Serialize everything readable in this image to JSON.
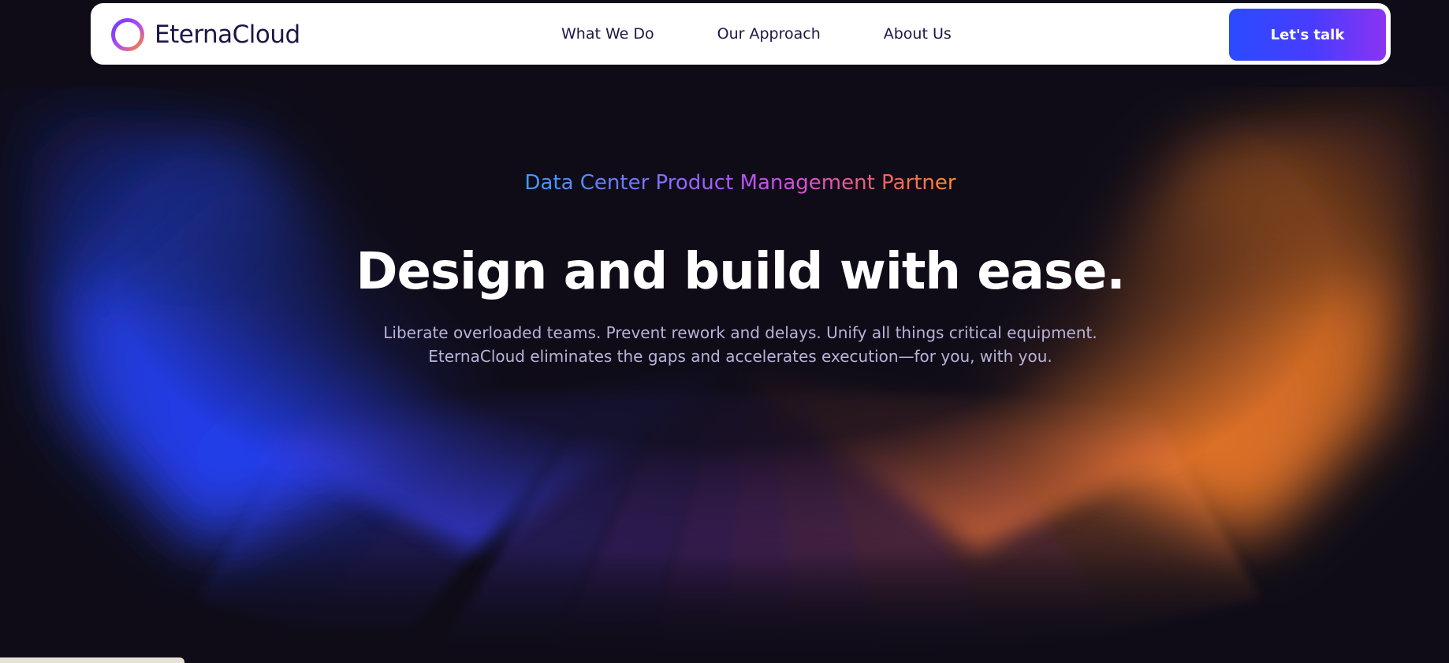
{
  "brand": {
    "name": "EternaCloud",
    "ring_gradient": [
      "#6b3cff",
      "#b24bf0",
      "#ff8a2a"
    ]
  },
  "nav": {
    "links": [
      {
        "label": "What We Do"
      },
      {
        "label": "Our Approach"
      },
      {
        "label": "About Us"
      }
    ],
    "cta_label": "Let's talk"
  },
  "hero": {
    "eyebrow": "Data Center Product Management Partner",
    "headline": "Design and build with ease.",
    "subtext_line1": "Liberate overloaded teams. Prevent rework and delays. Unify all things critical equipment.",
    "subtext_line2": "EternaCloud eliminates the gaps and accelerates execution—for you, with you."
  },
  "colors": {
    "background": "#0f0c18",
    "accent_blue": "#2a4bff",
    "accent_purple": "#8b34f2",
    "accent_orange": "#f07a2a",
    "text_dark": "#1c1747"
  }
}
